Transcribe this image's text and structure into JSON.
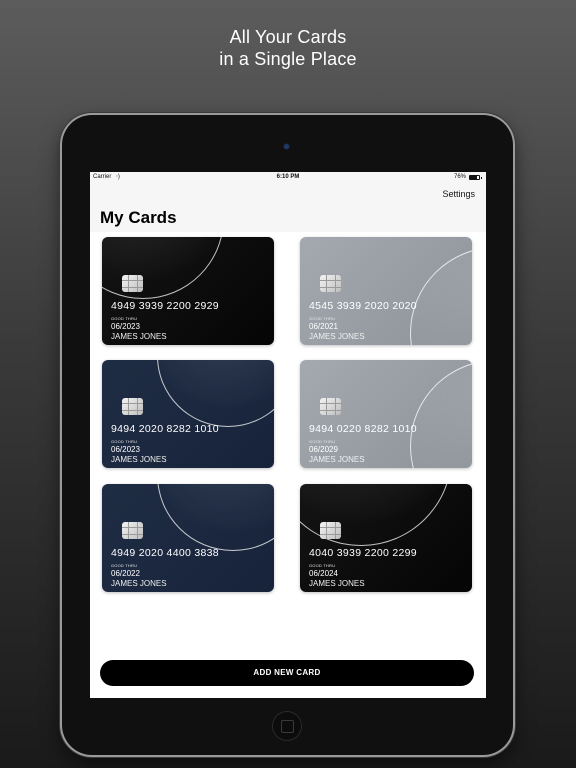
{
  "headline": {
    "line1": "All Your Cards",
    "line2": "in a Single Place"
  },
  "statusbar": {
    "carrier": "Carrier",
    "time": "6:10 PM",
    "battery": "76%"
  },
  "navbar": {
    "settings_label": "Settings",
    "title": "My Cards"
  },
  "cards": [
    {
      "number": "4949 3939 2200 2929",
      "good_thru_label": "GOOD THRU",
      "expiry": "06/2023",
      "holder": "JAMES JONES",
      "theme": "black"
    },
    {
      "number": "4545 3939 2020 2020",
      "good_thru_label": "GOOD THRU",
      "expiry": "06/2021",
      "holder": "JAMES JONES",
      "theme": "gray"
    },
    {
      "number": "9494 2020 8282 1010",
      "good_thru_label": "GOOD THRU",
      "expiry": "06/2023",
      "holder": "JAMES JONES",
      "theme": "navy"
    },
    {
      "number": "9494 0220 8282 1010",
      "good_thru_label": "GOOD THRU",
      "expiry": "06/2029",
      "holder": "JAMES JONES",
      "theme": "gray"
    },
    {
      "number": "4949 2020 4400 3838",
      "good_thru_label": "GOOD THRU",
      "expiry": "06/2022",
      "holder": "JAMES JONES",
      "theme": "navy"
    },
    {
      "number": "4040 3939 2200 2299",
      "good_thru_label": "GOOD THRU",
      "expiry": "06/2024",
      "holder": "JAMES JONES",
      "theme": "black"
    }
  ],
  "add_button_label": "ADD NEW CARD",
  "colors": {
    "card_black": "#0b0b0b",
    "card_navy": "#1b283f",
    "card_gray": "#9a9fa6",
    "button": "#000000"
  }
}
